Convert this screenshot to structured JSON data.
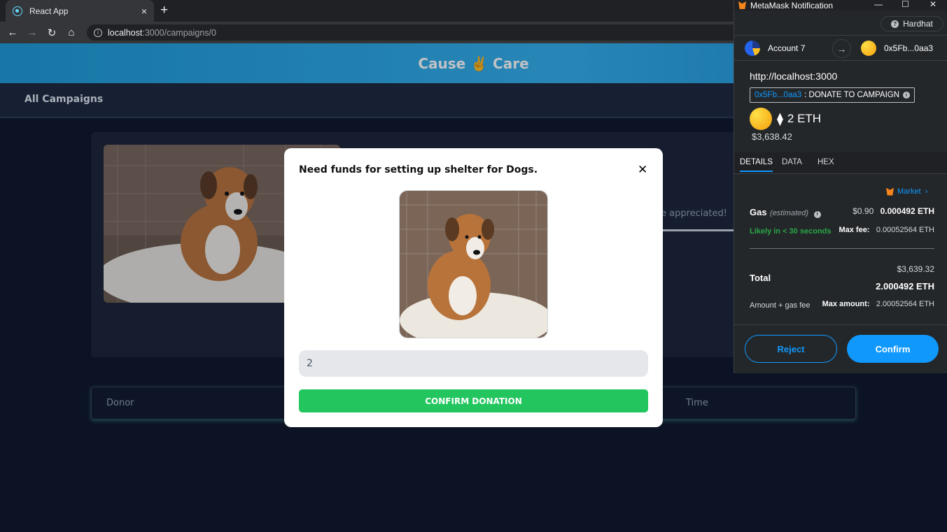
{
  "browser": {
    "tab_title": "React App",
    "tab_close": "×",
    "new_tab": "+",
    "url_host": "localhost",
    "url_path": ":3000/campaigns/0"
  },
  "page": {
    "brand": "Cause ✌️ Care",
    "nav_all_campaigns": "All Campaigns",
    "appreciated_text": "e appreciated!",
    "table_headers": [
      "Donor",
      "Time"
    ]
  },
  "modal": {
    "title": "Need funds for setting up shelter for Dogs.",
    "close": "✕",
    "amount_value": "2",
    "confirm_label": "CONFIRM DONATION"
  },
  "metamask": {
    "window_title": "MetaMask Notification",
    "network": "Hardhat",
    "from_account": "Account 7",
    "to_address": "0x5Fb...0aa3",
    "origin": "http://localhost:3000",
    "contract_addr": "0x5Fb...0aa3",
    "method": ": DONATE TO CAMPAIGN",
    "eth_amount": "2 ETH",
    "usd_amount": "$3,638.42",
    "tabs": [
      "DETAILS",
      "DATA",
      "HEX"
    ],
    "market_label": "Market",
    "gas_label": "Gas",
    "gas_est": "(estimated)",
    "gas_usd": "$0.90",
    "gas_eth": "0.000492 ETH",
    "likely": "Likely in < 30 seconds",
    "max_fee_label": "Max fee:",
    "max_fee_value": "0.00052564 ETH",
    "total_label": "Total",
    "total_usd": "$3,639.32",
    "total_eth": "2.000492 ETH",
    "amount_gas_label": "Amount + gas fee",
    "max_amount_label": "Max amount:",
    "max_amount_value": "2.00052564 ETH",
    "reject": "Reject",
    "confirm": "Confirm"
  },
  "colors": {
    "accent_blue": "#1098fc",
    "success_green": "#22c55e",
    "page_bg": "#0f172a",
    "hero_blue": "#34b1ec"
  }
}
